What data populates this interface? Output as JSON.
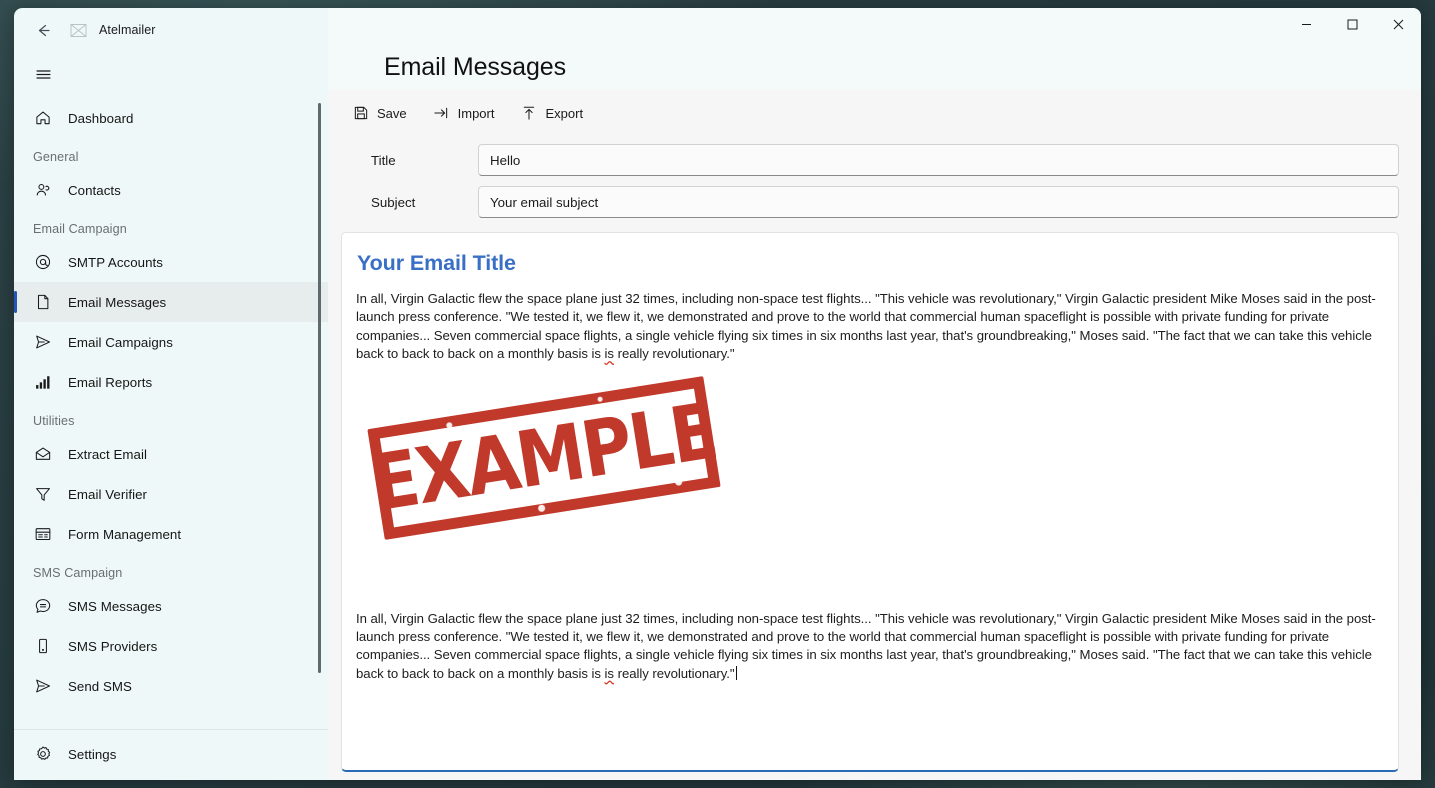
{
  "window": {
    "app_title": "Atelmailer",
    "back_icon": "back-arrow-icon",
    "app_icon": "missing-image-icon",
    "minimize_label": "–",
    "maximize_label": "□",
    "close_label": "✕"
  },
  "sidebar": {
    "hamburger_icon": "hamburger-menu-icon",
    "items": [
      {
        "type": "item",
        "label": "Dashboard",
        "icon": "home-icon",
        "selected": false
      },
      {
        "type": "group",
        "label": "General"
      },
      {
        "type": "item",
        "label": "Contacts",
        "icon": "people-icon",
        "selected": false
      },
      {
        "type": "group",
        "label": "Email Campaign"
      },
      {
        "type": "item",
        "label": "SMTP Accounts",
        "icon": "at-sign-icon",
        "selected": false
      },
      {
        "type": "item",
        "label": "Email Messages",
        "icon": "document-icon",
        "selected": true
      },
      {
        "type": "item",
        "label": "Email Campaigns",
        "icon": "send-icon",
        "selected": false
      },
      {
        "type": "item",
        "label": "Email Reports",
        "icon": "bar-chart-icon",
        "selected": false
      },
      {
        "type": "group",
        "label": "Utilities"
      },
      {
        "type": "item",
        "label": "Extract Email",
        "icon": "envelope-icon",
        "selected": false
      },
      {
        "type": "item",
        "label": "Email Verifier",
        "icon": "funnel-icon",
        "selected": false
      },
      {
        "type": "item",
        "label": "Form Management",
        "icon": "form-icon",
        "selected": false
      },
      {
        "type": "group",
        "label": "SMS Campaign"
      },
      {
        "type": "item",
        "label": "SMS Messages",
        "icon": "chat-bubble-icon",
        "selected": false
      },
      {
        "type": "item",
        "label": "SMS Providers",
        "icon": "phone-icon",
        "selected": false
      },
      {
        "type": "item",
        "label": "Send SMS",
        "icon": "send-icon",
        "selected": false
      }
    ],
    "footer_item": {
      "label": "Settings",
      "icon": "gear-icon"
    }
  },
  "main": {
    "page_title": "Email Messages",
    "toolbar": [
      {
        "label": "Save",
        "icon": "floppy-disk-icon"
      },
      {
        "label": "Import",
        "icon": "import-arrow-icon"
      },
      {
        "label": "Export",
        "icon": "export-arrow-icon"
      }
    ],
    "form": {
      "title_label": "Title",
      "title_value": "Hello",
      "title_placeholder": "Title",
      "subject_label": "Subject",
      "subject_value": "",
      "subject_placeholder": "Your email subject"
    },
    "editor": {
      "heading": "Your Email Title",
      "paragraph_1_a": "In all, Virgin Galactic flew the space plane just 32 times, including non-space test flights... \"This vehicle was revolutionary,\" Virgin Galactic president Mike Moses said in the post-launch press conference. \"We tested it, we flew it, we demonstrated and prove to the world that commercial human spaceflight is possible with private funding for private companies... Seven commercial space flights, a single vehicle flying six times in six months last year, that's groundbreaking,\" Moses said. \"The fact that we can take this vehicle back to back to back on a monthly basis is ",
      "paragraph_1_spell": "is",
      "paragraph_1_b": " really revolutionary.\"",
      "image_alt": "EXAMPLE",
      "stamp_text": "EXAMPLE",
      "paragraph_2_a": "In all, Virgin Galactic flew the space plane just 32 times, including non-space test flights... \"This vehicle was revolutionary,\" Virgin Galactic president Mike Moses said in the post-launch press conference. \"We tested it, we flew it, we demonstrated and prove to the world that commercial human spaceflight is possible with private funding for private companies... Seven commercial space flights, a single vehicle flying six times in six months last year, that's groundbreaking,\" Moses said. \"The fact that we can take this vehicle back to back to back on a monthly basis is ",
      "paragraph_2_spell": "is",
      "paragraph_2_b": " really revolutionary.\""
    }
  },
  "colors": {
    "desktop": "#2b4046",
    "sidebar_bg": "#eff8f8",
    "sidebar_selected": "#e7eded",
    "accent_selection": "#2556b5",
    "main_bg": "#f6f6f6",
    "header_bg": "#f4fafa",
    "editor_focus_border": "#2a6ab5",
    "email_heading": "#3a6fc6",
    "stamp_red": "#c0392b",
    "spell_error": "#d43a2a"
  }
}
